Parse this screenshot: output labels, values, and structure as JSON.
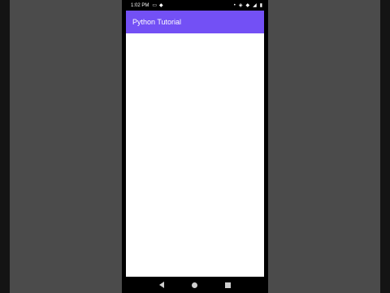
{
  "status_bar": {
    "time": "1:02 PM",
    "left_icons": [
      "camera-icon",
      "wifi-icon"
    ],
    "right_icons": [
      "signal-dot-icon",
      "vibrate-icon",
      "wifi-icon",
      "signal-icon",
      "battery-icon"
    ]
  },
  "app_bar": {
    "title": "Python Tutorial",
    "color": "#7350f5"
  },
  "nav_bar": {
    "buttons": [
      "back-icon",
      "home-icon",
      "recents-icon"
    ]
  }
}
